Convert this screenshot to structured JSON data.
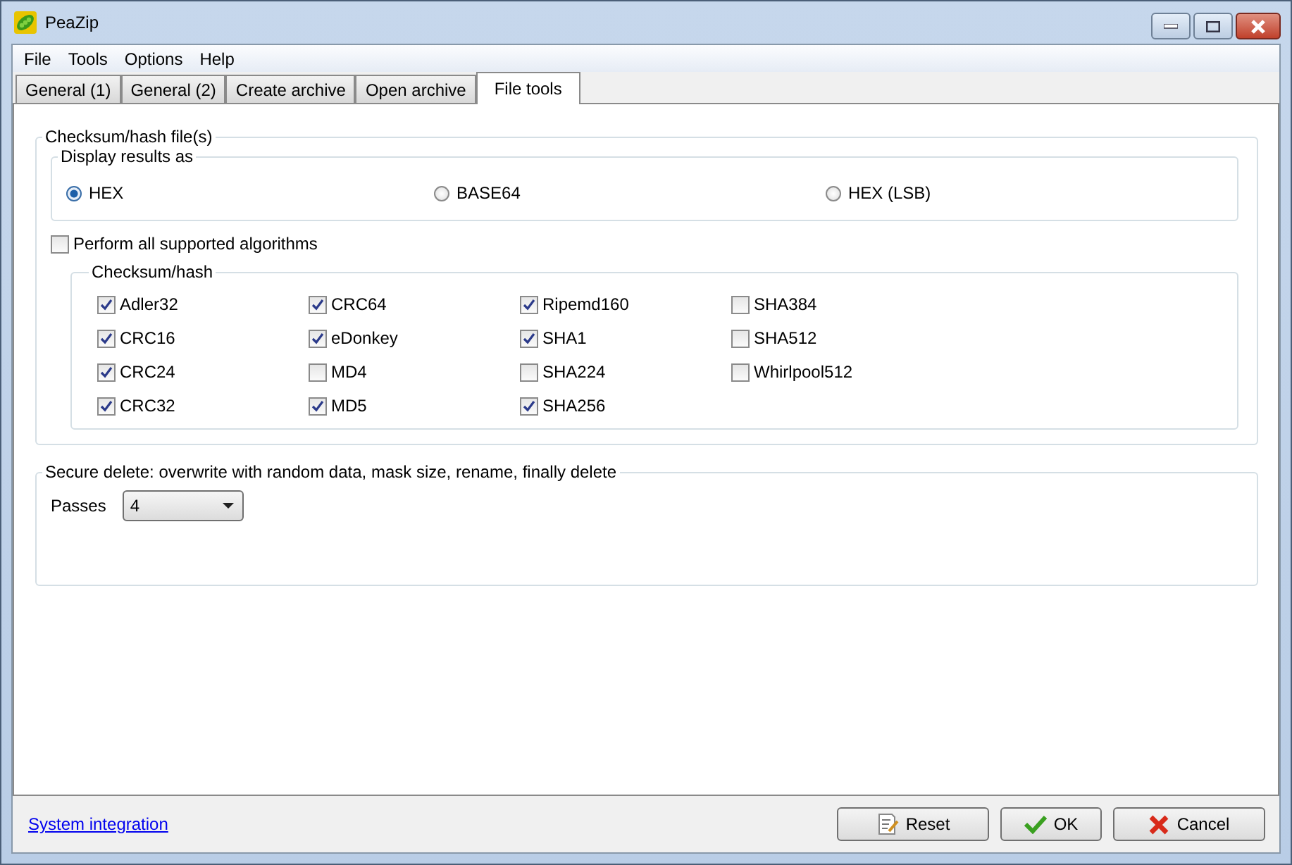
{
  "window": {
    "title": "PeaZip"
  },
  "menu": [
    "File",
    "Tools",
    "Options",
    "Help"
  ],
  "tabs": [
    {
      "label": "General (1)",
      "selected": false
    },
    {
      "label": "General (2)",
      "selected": false
    },
    {
      "label": "Create archive",
      "selected": false
    },
    {
      "label": "Open archive",
      "selected": false
    },
    {
      "label": "File tools",
      "selected": true
    }
  ],
  "checksum_group": {
    "title": "Checksum/hash file(s)",
    "display_results": {
      "title": "Display results as",
      "options": [
        {
          "label": "HEX",
          "selected": true
        },
        {
          "label": "BASE64",
          "selected": false
        },
        {
          "label": "HEX (LSB)",
          "selected": false
        }
      ]
    },
    "perform_all": {
      "label": "Perform all supported algorithms",
      "checked": false
    },
    "algorithms": {
      "title": "Checksum/hash",
      "items": [
        {
          "label": "Adler32",
          "checked": true
        },
        {
          "label": "CRC16",
          "checked": true
        },
        {
          "label": "CRC24",
          "checked": true
        },
        {
          "label": "CRC32",
          "checked": true
        },
        {
          "label": "CRC64",
          "checked": true
        },
        {
          "label": "eDonkey",
          "checked": true
        },
        {
          "label": "MD4",
          "checked": false
        },
        {
          "label": "MD5",
          "checked": true
        },
        {
          "label": "Ripemd160",
          "checked": true
        },
        {
          "label": "SHA1",
          "checked": true
        },
        {
          "label": "SHA224",
          "checked": false
        },
        {
          "label": "SHA256",
          "checked": true
        },
        {
          "label": "SHA384",
          "checked": false
        },
        {
          "label": "SHA512",
          "checked": false
        },
        {
          "label": "Whirlpool512",
          "checked": false
        }
      ]
    }
  },
  "secure_delete": {
    "title": "Secure delete: overwrite with random data, mask size, rename, finally delete",
    "passes_label": "Passes",
    "passes_value": "4"
  },
  "footer": {
    "link": "System integration",
    "buttons": [
      {
        "label": "Reset",
        "kind": "reset"
      },
      {
        "label": "OK",
        "kind": "ok"
      },
      {
        "label": "Cancel",
        "kind": "cancel"
      }
    ]
  }
}
